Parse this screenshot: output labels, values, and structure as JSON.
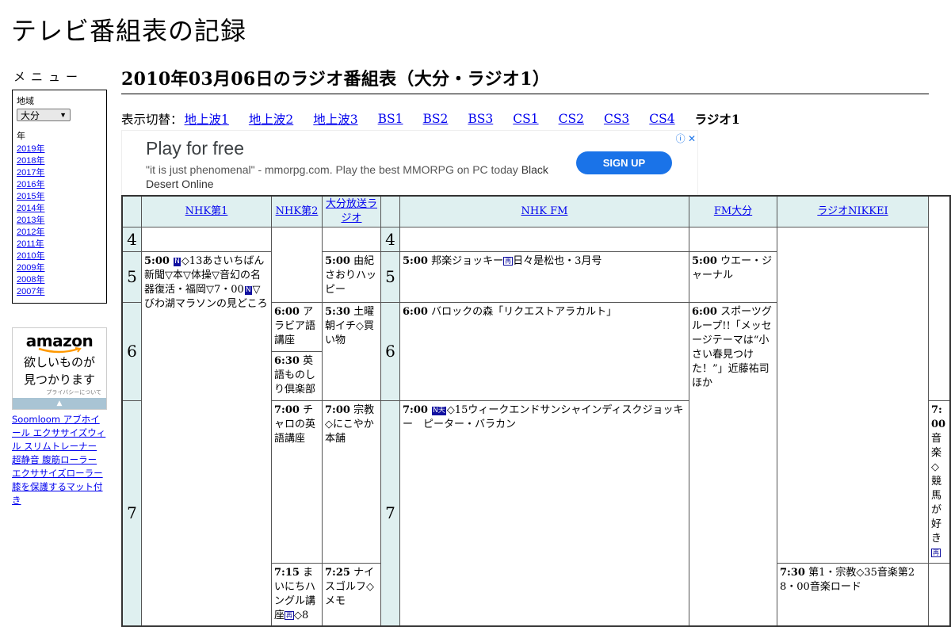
{
  "site_title": "テレビ番組表の記録",
  "sidebar": {
    "menu_heading": "メニュー",
    "region_label": "地域",
    "region_value": "大分",
    "year_label": "年",
    "years": [
      "2019年",
      "2018年",
      "2017年",
      "2016年",
      "2015年",
      "2014年",
      "2013年",
      "2012年",
      "2011年",
      "2010年",
      "2009年",
      "2008年",
      "2007年"
    ],
    "amazon": {
      "logo": "amazon",
      "tagline_1": "欲しいものが",
      "tagline_2": "見つかります",
      "privacy": "プライバシーについて",
      "scroll": "▲"
    },
    "links": "Soomloom アブホイール エクササイズウィル スリムトレーナー 超静音 腹筋ローラー エクササイズローラー 膝を保護するマット付き"
  },
  "main": {
    "heading": "2010年03月06日のラジオ番組表（大分・ラジオ1）",
    "switch_label": "表示切替：",
    "switch_links": [
      "地上波1",
      "地上波2",
      "地上波3",
      "BS1",
      "BS2",
      "BS3",
      "CS1",
      "CS2",
      "CS3",
      "CS4"
    ],
    "switch_current": "ラジオ1"
  },
  "ad": {
    "title": "Play for free",
    "text": "\"it is just phenomenal\" - mmorpg.com. Play the best MMORPG on PC today",
    "text_bold": "Black Desert Online",
    "button": "SIGN UP",
    "icons": "ⓘ ✕"
  },
  "schedule": {
    "channels": [
      "NHK第1",
      "NHK第2",
      "大分放送ラジオ",
      "NHK FM",
      "FM大分",
      "ラジオNIKKEI"
    ],
    "hours": [
      "4",
      "5",
      "6",
      "7"
    ],
    "icons": {
      "n": "N",
      "n_tennki": "N天",
      "sq": "再"
    },
    "programs": {
      "nhk1_5": {
        "time": "5:00",
        "a": "◇13あさいちばん新聞▽本▽体操▽音幻の名器復活・福岡▽7・00",
        "b": "▽びわ湖マラソンの見どころ"
      },
      "nhk2_6a": {
        "time": "6:00",
        "title": "アラビア語講座"
      },
      "nhk2_6b": {
        "time": "6:30",
        "title": "英語ものしり倶楽部"
      },
      "nhk2_7a": {
        "time": "7:00",
        "title": "チャロの英語講座"
      },
      "nhk2_7b": {
        "time": "7:15",
        "title": "まいにちハングル講座",
        "tail": "◇8"
      },
      "obs_5": {
        "time": "5:00",
        "title": "由紀さおりハッピー"
      },
      "obs_530": {
        "time": "5:30",
        "title": "土曜朝イチ◇買い物"
      },
      "obs_7a": {
        "time": "7:00",
        "title": "宗教◇にこやか本舗"
      },
      "obs_7b": {
        "time": "7:25",
        "title": "ナイスゴルフ◇メモ"
      },
      "fm_5": {
        "time": "5:00",
        "title": "邦楽ジョッキー",
        "tail": "日々是松也・3月号"
      },
      "fm_6": {
        "time": "6:00",
        "title": "バロックの森「リクエストアラカルト」"
      },
      "fm_7": {
        "time": "7:00",
        "title": "◇15ウィークエンドサンシャインディスクジョッキー　ピーター・バラカン"
      },
      "fmo_5": {
        "time": "5:00",
        "title": "ウエー・ジャーナル"
      },
      "fmo_6": {
        "time": "6:00",
        "title": "スポーツグループ!!「メッセージテーマは“小さい春見つけた！”」近藤祐司ほか"
      },
      "nikkei_7a": {
        "time": "7:00",
        "title": "音楽◇競馬が好き"
      },
      "nikkei_7b": {
        "time": "7:30",
        "title": "第1・宗教◇35音楽第28・00音楽ロード"
      }
    }
  },
  "colors": {
    "link": "#0000ee",
    "header_bg": "#dff0f0",
    "ad_button": "#1a73e8"
  }
}
